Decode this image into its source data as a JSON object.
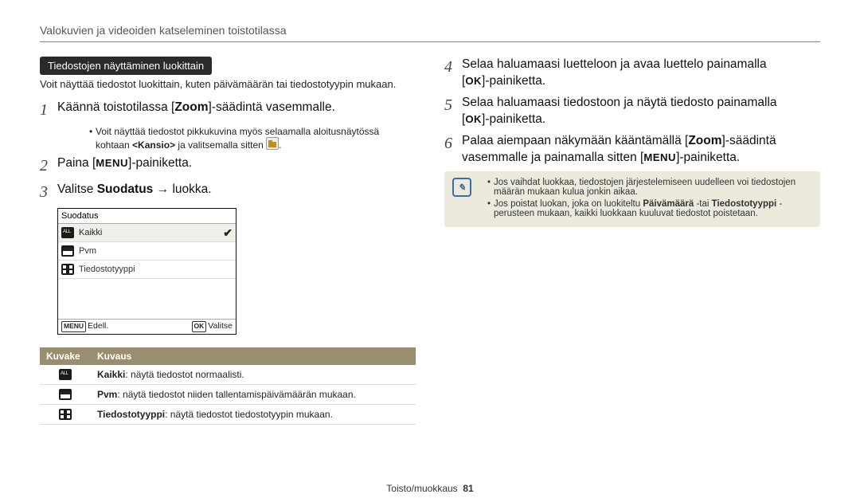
{
  "header": "Valokuvien ja videoiden katseleminen toistotilassa",
  "section_pill": "Tiedostojen näyttäminen luokittain",
  "intro_text": "Voit näyttää tiedostot luokittain, kuten päivämäärän tai tiedostotyypin mukaan.",
  "step1_num": "1",
  "step1_pre": "Käännä toistotilassa [",
  "step1_bold": "Zoom",
  "step1_post": "]-säädintä vasemmalle.",
  "step1_sub_pre": "Voit näyttää tiedostot pikkukuvina myös selaamalla aloitusnäytössä kohtaan ",
  "step1_sub_bold": "<Kansio>",
  "step1_sub_post": " ja valitsemalla sitten",
  "step2_num": "2",
  "step2_pre": "Paina [",
  "step2_menu": "MENU",
  "step2_post": "]-painiketta.",
  "step3_num": "3",
  "step3_pre": "Valitse ",
  "step3_bold": "Suodatus",
  "step3_arrow": " → ",
  "step3_post": "luokka.",
  "ui": {
    "title": "Suodatus",
    "row1": "Kaikki",
    "row2": "Pvm",
    "row3": "Tiedostotyyppi",
    "foot_left_btn": "MENU",
    "foot_left": "Edell.",
    "foot_right_btn": "OK",
    "foot_right": "Valitse",
    "check": "✔"
  },
  "table": {
    "h1": "Kuvake",
    "h2": "Kuvaus",
    "r1_bold": "Kaikki",
    "r1_rest": ": näytä tiedostot normaalisti.",
    "r2_bold": "Pvm",
    "r2_rest": ": näytä tiedostot niiden tallentamispäivämäärän mukaan.",
    "r3_bold": "Tiedostotyyppi",
    "r3_rest": ": näytä tiedostot tiedostotyypin mukaan."
  },
  "step4_num": "4",
  "step4_line1": "Selaa haluamaasi luetteloon ja avaa luettelo painamalla",
  "step4_line2_pre": "[",
  "step4_line2_ok": "OK",
  "step4_line2_post": "]-painiketta.",
  "step5_num": "5",
  "step5_line1": "Selaa haluamaasi tiedostoon ja näytä tiedosto painamalla",
  "step5_line2_pre": "[",
  "step5_line2_ok": "OK",
  "step5_line2_post": "]-painiketta.",
  "step6_num": "6",
  "step6_pre": "Palaa aiempaan näkymään kääntämällä [",
  "step6_bold": "Zoom",
  "step6_mid": "]-säädintä vasemmalle ja painamalla sitten [",
  "step6_menu": "MENU",
  "step6_post": "]-painiketta.",
  "note": {
    "bullet1": "Jos vaihdat luokkaa, tiedostojen järjestelemiseen uudelleen voi tiedostojen määrän mukaan kulua jonkin aikaa.",
    "bullet2_pre": "Jos poistat luokan, joka on luokiteltu ",
    "bullet2_bold1": "Päivämäärä",
    "bullet2_mid": " -tai ",
    "bullet2_bold2": "Tiedostotyyppi",
    "bullet2_post": " -perusteen mukaan, kaikki luokkaan kuuluvat tiedostot poistetaan."
  },
  "footer_section": "Toisto/muokkaus",
  "footer_page": "81"
}
